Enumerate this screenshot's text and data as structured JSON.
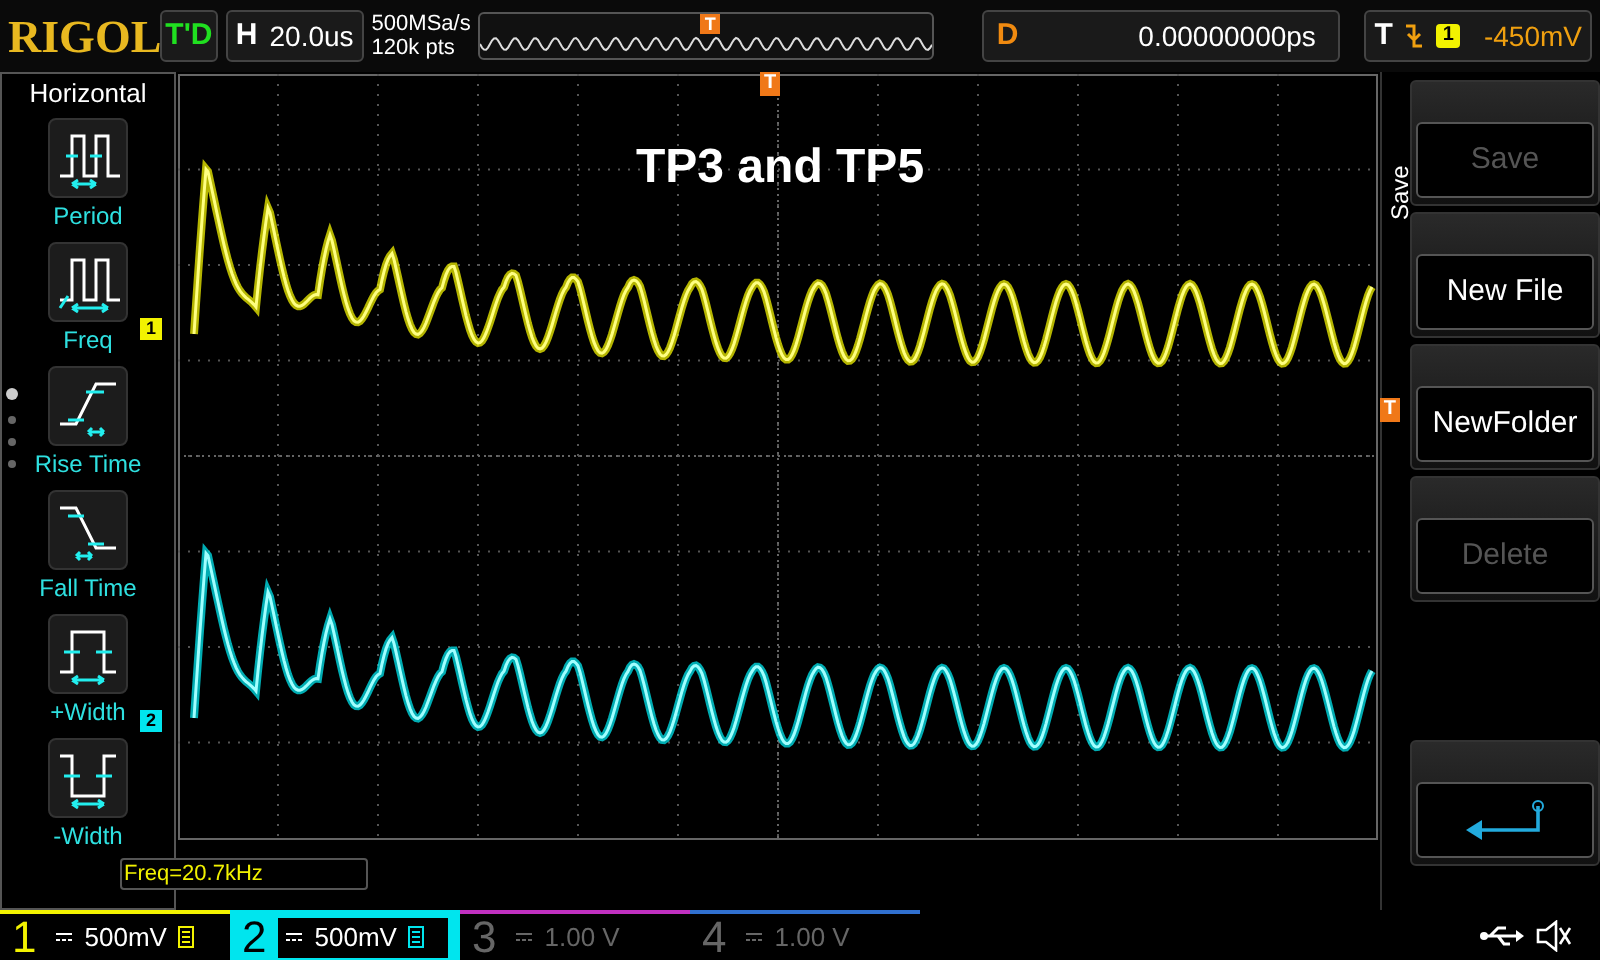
{
  "brand": "RIGOL",
  "run_state": "T'D",
  "horizontal": {
    "label": "H",
    "timebase": "20.0us"
  },
  "acquisition": {
    "sample_rate": "500MSa/s",
    "memory_depth": "120k pts"
  },
  "memory_marker": "T",
  "delay": {
    "label": "D",
    "value": "0.00000000ps"
  },
  "trigger": {
    "label": "T",
    "source": "1",
    "level": "-450mV"
  },
  "left_menu": {
    "title": "Horizontal",
    "items": [
      {
        "kind": "period",
        "label": "Period"
      },
      {
        "kind": "freq",
        "label": "Freq"
      },
      {
        "kind": "rise",
        "label": "Rise Time"
      },
      {
        "kind": "fall",
        "label": "Fall Time"
      },
      {
        "kind": "pwidth",
        "label": "+Width"
      },
      {
        "kind": "nwidth",
        "label": "-Width"
      }
    ]
  },
  "screen": {
    "annotation": "TP3 and TP5",
    "trigger_position_marker": "T",
    "trigger_level_marker": "T",
    "channel_markers": [
      {
        "label": "1",
        "color": "#f2f200"
      },
      {
        "label": "2",
        "color": "#00e5ee"
      }
    ],
    "measurement": "Freq=20.7kHz"
  },
  "right_menu": {
    "title": "Save",
    "items": [
      {
        "kind": "text",
        "label": "Save",
        "disabled": true
      },
      {
        "kind": "text",
        "label": "New File",
        "disabled": false
      },
      {
        "kind": "text",
        "label": "NewFolder",
        "disabled": false
      },
      {
        "kind": "text",
        "label": "Delete",
        "disabled": true
      },
      {
        "kind": "back"
      }
    ]
  },
  "channels": [
    {
      "number": "1",
      "scale": "500mV",
      "on": true,
      "selected": false,
      "color": "#f2f200"
    },
    {
      "number": "2",
      "scale": "500mV",
      "on": true,
      "selected": true,
      "color": "#00e5ee"
    },
    {
      "number": "3",
      "scale": "1.00 V",
      "on": false,
      "selected": false,
      "color": "#c030c0"
    },
    {
      "number": "4",
      "scale": "1.00 V",
      "on": false,
      "selected": false,
      "color": "#3070d0"
    }
  ]
}
